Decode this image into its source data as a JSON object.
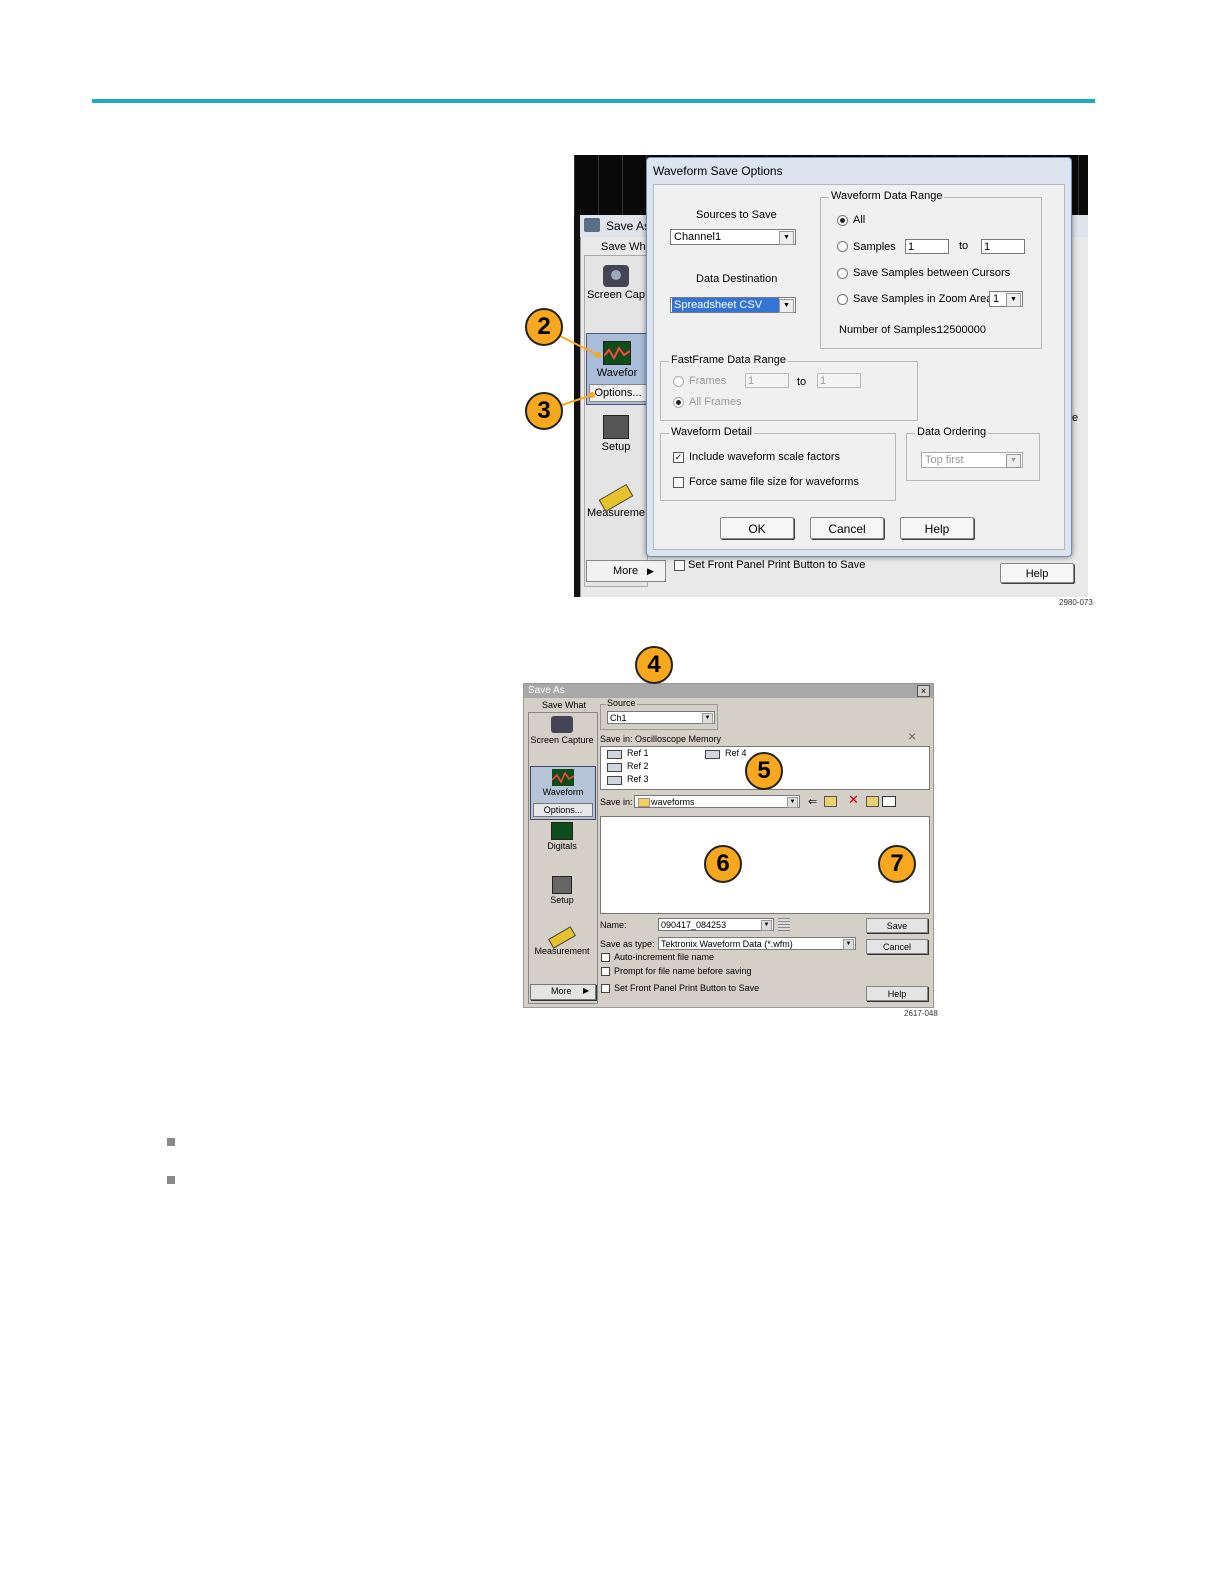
{
  "figure1": {
    "saveas_title": "Save As",
    "save_what": "Save Wh",
    "side_items": {
      "screen_capture": "Screen Cap",
      "waveform": "Wavefor",
      "options": "Options...",
      "setup": "Setup",
      "measurement": "Measureme",
      "more": "More"
    },
    "right_edge_letter": "e",
    "bottom_checkbox_label": "Set Front Panel Print Button to Save",
    "bottom_help": "Help",
    "dialog": {
      "title": "Waveform Save Options",
      "sources_label": "Sources to Save",
      "sources_value": "Channel1",
      "destination_label": "Data Destination",
      "destination_value": "Spreadsheet CSV",
      "range_group": "Waveform Data Range",
      "range_all": "All",
      "range_samples": "Samples",
      "samples_from": "1",
      "samples_to_label": "to",
      "samples_to": "1",
      "range_cursors": "Save Samples between Cursors",
      "range_zoom": "Save Samples in Zoom Area",
      "zoom_value": "1",
      "num_samples_label": "Number of Samples:",
      "num_samples_value": "12500000",
      "fastframe_group": "FastFrame Data Range",
      "ff_frames": "Frames",
      "ff_from": "1",
      "ff_to_label": "to",
      "ff_to": "1",
      "ff_all": "All Frames",
      "detail_group": "Waveform Detail",
      "detail_scale": "Include waveform scale factors",
      "detail_filesize": "Force same file size for waveforms",
      "ordering_group": "Data Ordering",
      "ordering_value": "Top first",
      "ok": "OK",
      "cancel": "Cancel",
      "help": "Help"
    },
    "callouts": [
      "2",
      "3"
    ],
    "figure_id": "2980-073"
  },
  "figure2": {
    "title": "Save As",
    "close": "×",
    "save_what": "Save What",
    "side_items": {
      "screen_capture": "Screen Capture",
      "waveform": "Waveform",
      "options": "Options...",
      "digitals": "Digitals",
      "setup": "Setup",
      "measurement": "Measurement",
      "more": "More"
    },
    "source_label": "Source",
    "source_value": "Ch1",
    "save_in_memory": "Save in: Oscilloscope Memory",
    "refs": [
      "Ref 1",
      "Ref 2",
      "Ref 3",
      "Ref 4"
    ],
    "save_in_label": "Save in:",
    "save_in_value": "waveforms",
    "name_label": "Name:",
    "name_value": "090417_084253",
    "save_type_label": "Save as type:",
    "save_type_value": "Tektronix Waveform Data (*.wfm)",
    "auto_increment": "Auto-increment file name",
    "prompt_name": "Prompt for file name before saving",
    "front_panel": "Set Front Panel Print Button to Save",
    "save_btn": "Save",
    "cancel_btn": "Cancel",
    "help_btn": "Help",
    "callouts": [
      "4",
      "5",
      "6",
      "7"
    ],
    "figure_id": "2617-048"
  },
  "colors": {
    "rule": "#20a8c8",
    "callout": "#f8a81e"
  }
}
